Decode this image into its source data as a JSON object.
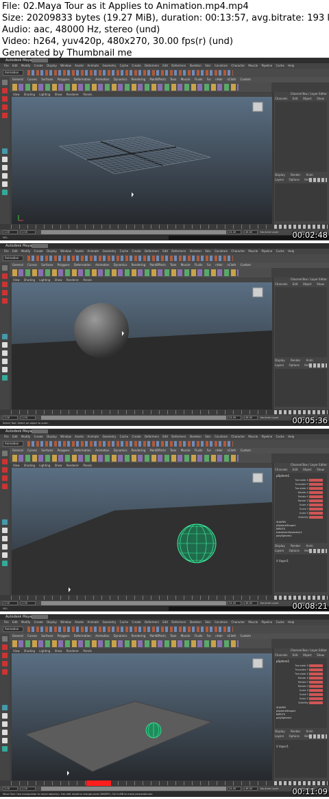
{
  "header": {
    "file": "File: 02.Maya Tour as it Applies to Animation.mp4.mp4",
    "size": "Size: 20209833 bytes (19.27 MiB), duration: 00:13:57, avg.bitrate: 193 kb",
    "audio": "Audio: aac, 48000 Hz, stereo (und)",
    "video": "Video: h264, yuv420p, 480x270, 30.00 fps(r) (und)",
    "generated": "Generated by Thumbnail me"
  },
  "maya": {
    "app_title": "Autodesk Maya",
    "menubar": "File Edit Modify Create Display Window Assets Animate Geometry Cache Create Deformers Edit Deformers Skeleton Skin Constrain Character Muscle Pipeline Cache Help",
    "mode": "Animation",
    "shelf_tabs": "General Curves Surfaces Polygons Deformation Animation Dynamics Rendering PaintEffects Toon Muscle Fluids Fur nHair nCloth Custom",
    "panel_menu": "View Shading Lighting Show Renderer Panels",
    "channel_box_title": "Channel Box / Layer Editor",
    "channel_box_menu": "Channels Edit Object Show",
    "layer_tabs": "Display Render Anim",
    "layer_menu": "Layers Options Help",
    "range_start": "1.00",
    "range_end": "24.00",
    "range_end_total": "48.00",
    "anim_layer": "No Anim Layer",
    "char_set": "No Character Set",
    "cmd_tag": "MEL"
  },
  "frames": [
    {
      "timestamp": "00:02:48",
      "scene": "grid",
      "helpline": "",
      "channel_box": null,
      "layer": null
    },
    {
      "timestamp": "00:05:36",
      "scene": "sphere-gray",
      "helpline": "Select Tool: Select an object to scale.",
      "channel_box": null,
      "layer": null
    },
    {
      "timestamp": "00:08:21",
      "scene": "sphere-wire",
      "helpline": "",
      "channel_box": {
        "node": "pSphere1",
        "attrs": [
          "Translate X",
          "Translate Y",
          "Translate Z",
          "Rotate X",
          "Rotate Y",
          "Rotate Z",
          "Scale X",
          "Scale Y",
          "Scale Z",
          "Visibility"
        ],
        "shapes_label": "SHAPES",
        "shapes": [
          "pSphereShape1"
        ],
        "inputs_label": "INPUTS",
        "inputs": [
          "transformGeometry1",
          "polySphere1"
        ]
      },
      "layer": "layer1"
    },
    {
      "timestamp": "00:11:09",
      "scene": "plane-sphere",
      "helpline": "Move Tool: Use manipulator to move object(s). Use edit mode to change pivot (INSERT). Ctrl+LMB to move perpendicular.",
      "channel_box": {
        "node": "pSphere1",
        "attrs": [
          "Translate X",
          "Translate Y",
          "Translate Z",
          "Rotate X",
          "Rotate Y",
          "Rotate Z",
          "Scale X",
          "Scale Y",
          "Scale Z",
          "Visibility"
        ],
        "shapes_label": "SHAPES",
        "shapes": [
          "pSphereShape1"
        ],
        "inputs_label": "INPUTS",
        "inputs": [
          "polySphere1"
        ]
      },
      "layer": "layer1"
    }
  ],
  "colors": {
    "key_red": "#ff1e1e",
    "wire_green": "#3ee89a",
    "cb_highlight": "#d25555"
  }
}
